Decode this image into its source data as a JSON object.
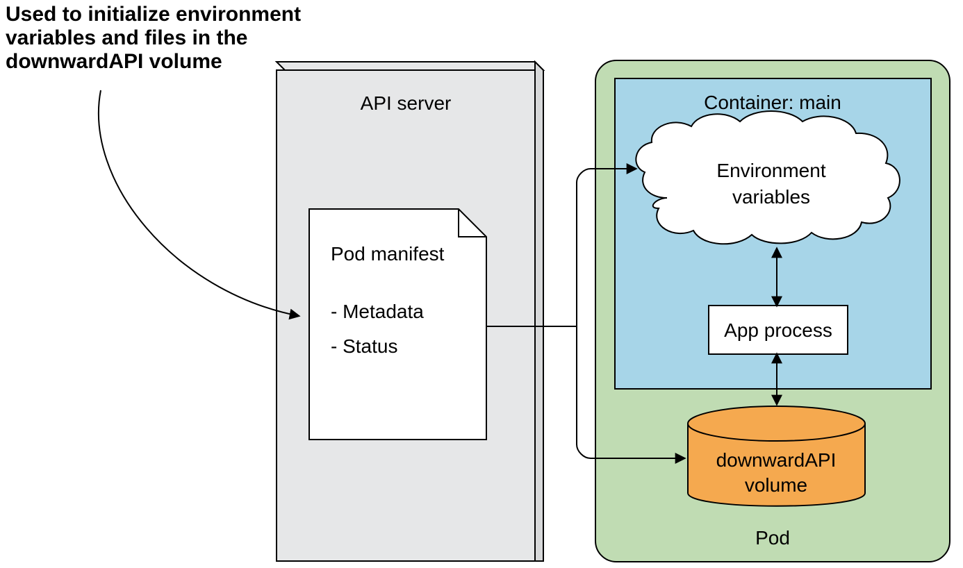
{
  "annotation": {
    "line1": "Used to initialize environment",
    "line2": "variables and files in the",
    "line3": "downwardAPI volume"
  },
  "apiServer": {
    "title": "API server",
    "manifest": {
      "title": "Pod manifest",
      "item1": "- Metadata",
      "item2": "- Status"
    }
  },
  "pod": {
    "title": "Pod",
    "container": {
      "title": "Container: main",
      "envVars": {
        "line1": "Environment",
        "line2": "variables"
      },
      "app": "App process"
    },
    "volume": {
      "line1": "downwardAPI",
      "line2": "volume"
    }
  },
  "colors": {
    "apiServerFill": "#e6e7e8",
    "podFill": "#c0dcb3",
    "containerFill": "#a7d5e8",
    "volumeFill": "#f5a94f",
    "stroke": "#000000"
  }
}
